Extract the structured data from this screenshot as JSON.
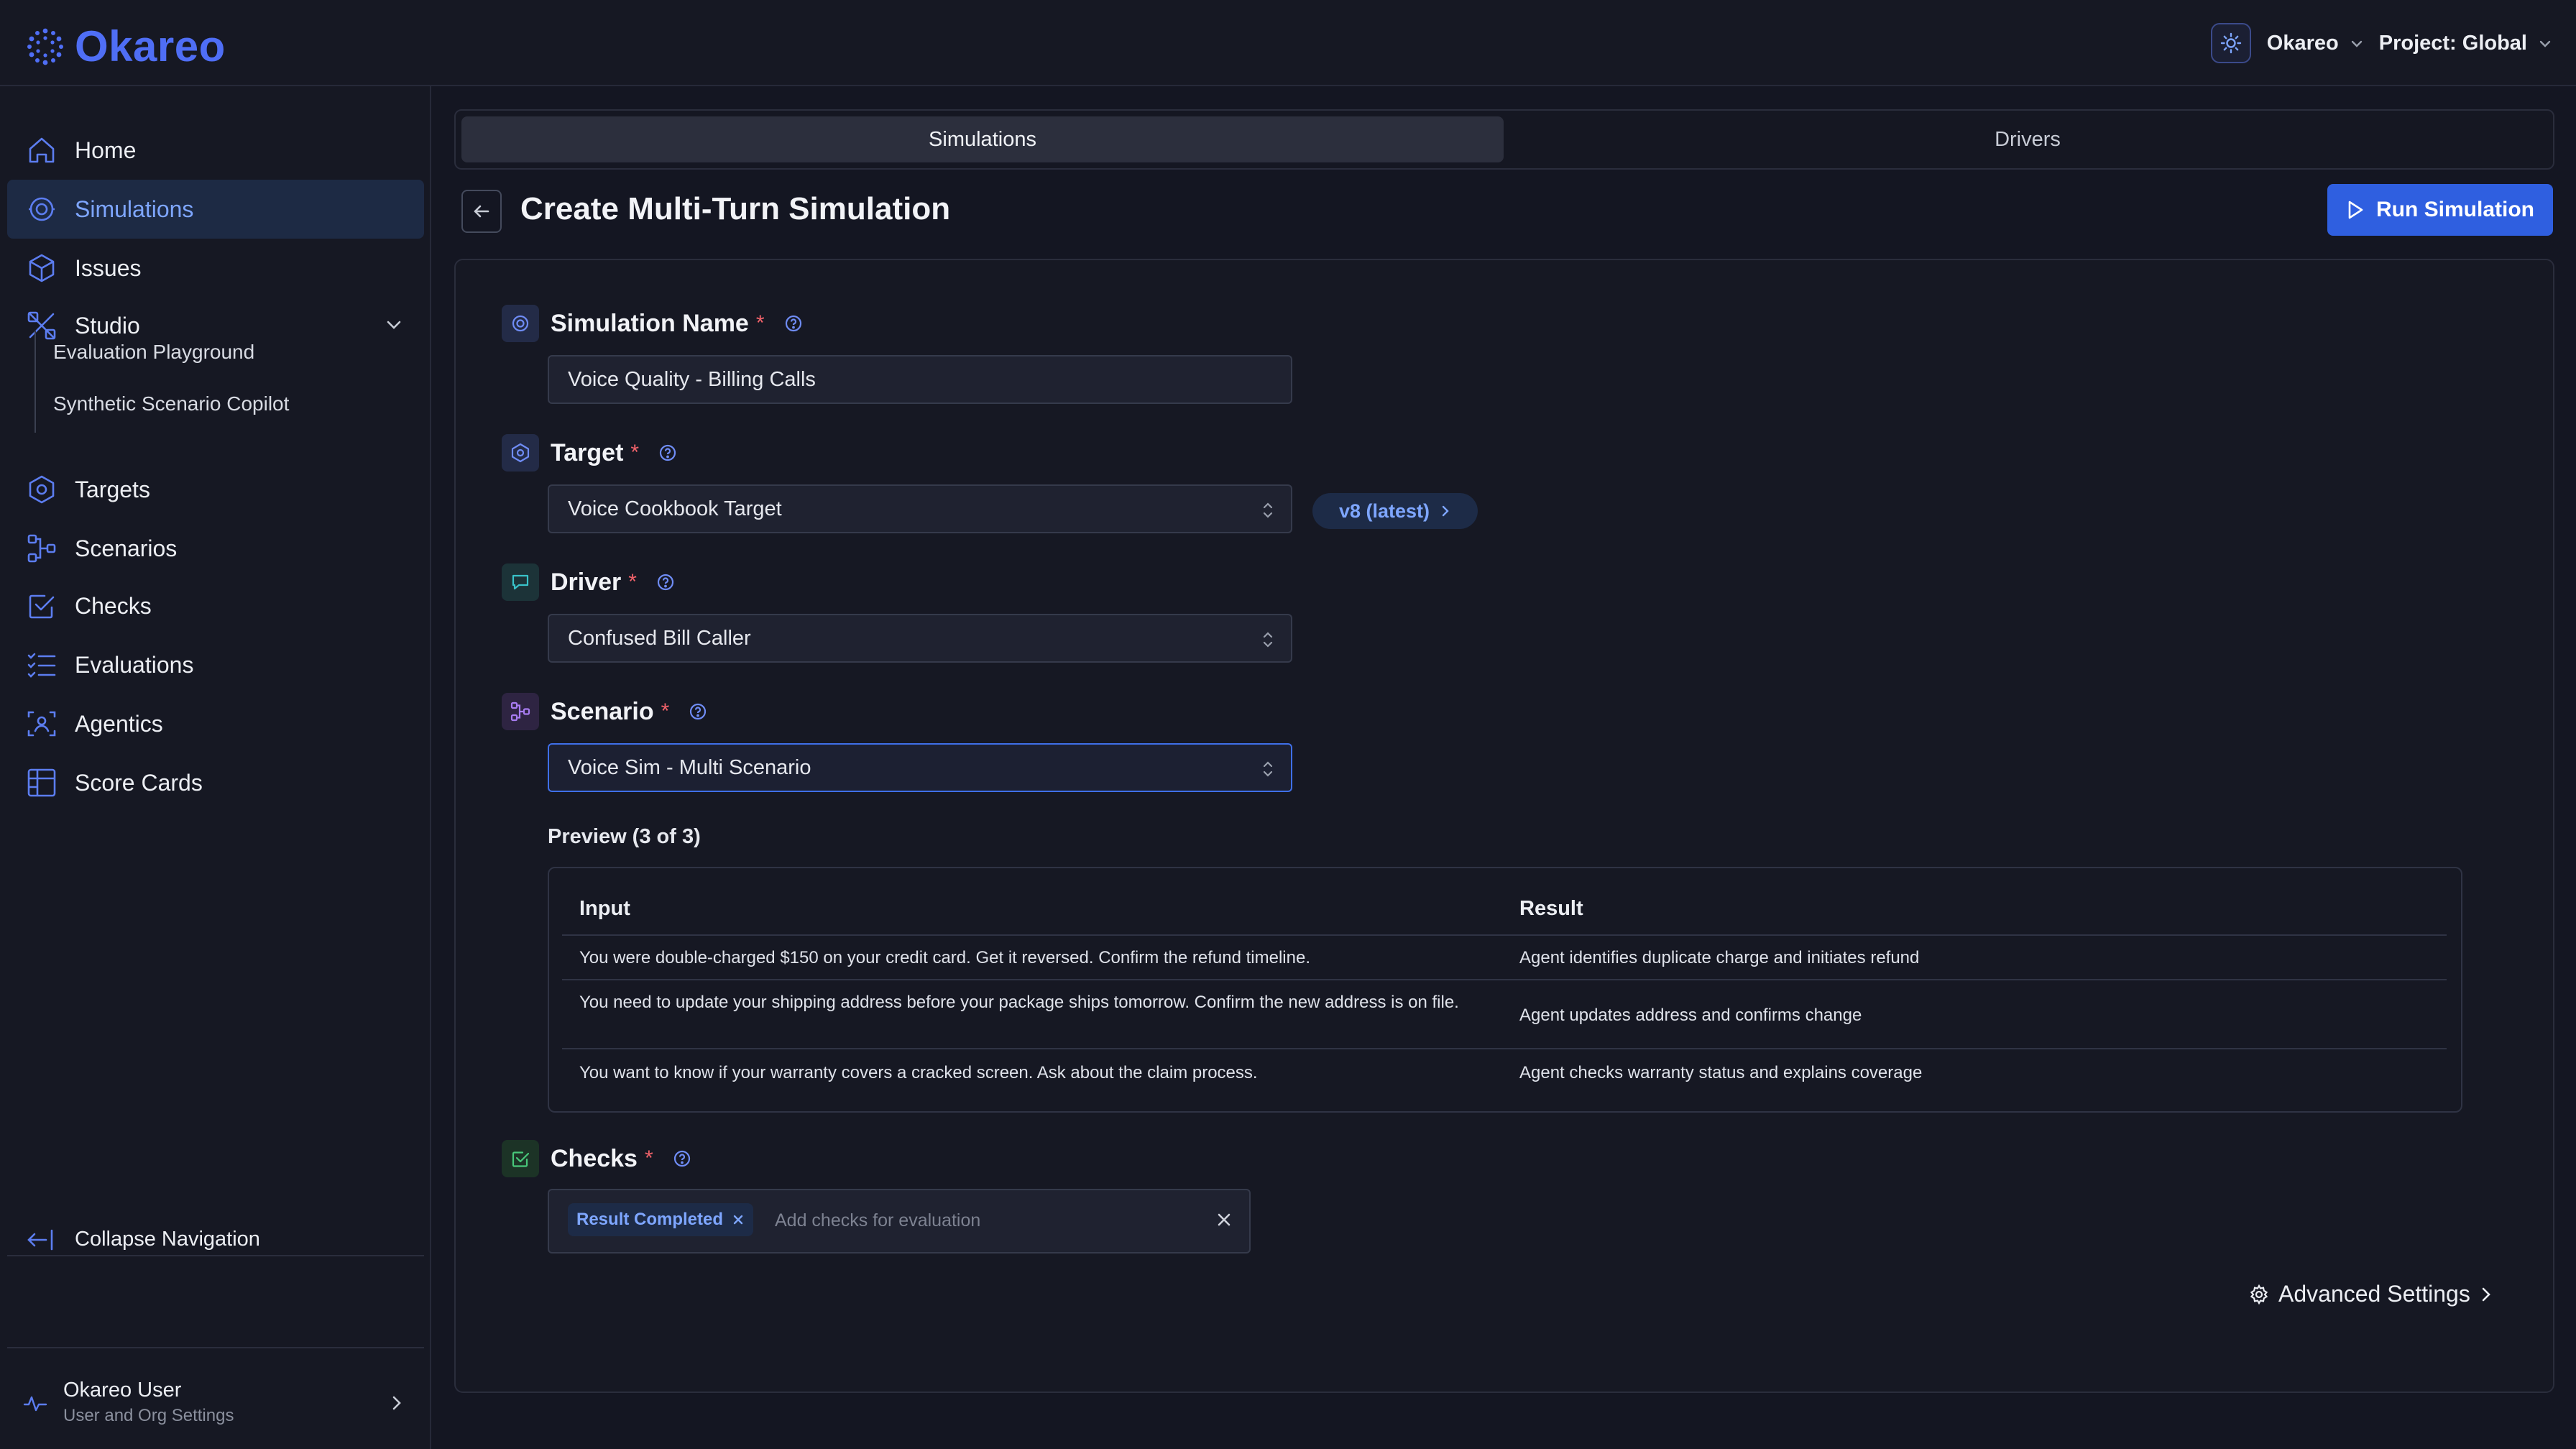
{
  "header": {
    "brand": "Okareo",
    "org": "Okareo",
    "project": "Project: Global"
  },
  "sidebar": {
    "items": [
      {
        "label": "Home"
      },
      {
        "label": "Simulations"
      },
      {
        "label": "Issues"
      },
      {
        "label": "Studio"
      },
      {
        "label": "Targets"
      },
      {
        "label": "Scenarios"
      },
      {
        "label": "Checks"
      },
      {
        "label": "Evaluations"
      },
      {
        "label": "Agentics"
      },
      {
        "label": "Score Cards"
      }
    ],
    "studio_sub": [
      "Evaluation Playground",
      "Synthetic Scenario Copilot"
    ],
    "collapse_label": "Collapse Navigation",
    "user_name": "Okareo User",
    "user_sub": "User and Org Settings"
  },
  "tabs": [
    "Simulations",
    "Drivers"
  ],
  "page": {
    "title": "Create Multi-Turn Simulation",
    "run_button": "Run Simulation"
  },
  "form": {
    "name_label": "Simulation Name",
    "name_value": "Voice Quality - Billing Calls",
    "target_label": "Target",
    "target_value": "Voice Cookbook Target",
    "target_version": "v8 (latest)",
    "driver_label": "Driver",
    "driver_value": "Confused Bill Caller",
    "scenario_label": "Scenario",
    "scenario_value": "Voice Sim - Multi Scenario",
    "required_mark": "*",
    "preview_label": "Preview (3 of 3)",
    "preview_headers": [
      "Input",
      "Result"
    ],
    "preview_rows": [
      {
        "input": "You were double-charged $150 on your credit card. Get it reversed. Confirm the refund timeline.",
        "result": "Agent identifies duplicate charge and initiates refund"
      },
      {
        "input": "You need to update your shipping address before your package ships tomorrow. Confirm the new address is on file.",
        "result": "Agent updates address and confirms change"
      },
      {
        "input": "You want to know if your warranty covers a cracked screen. Ask about the claim process.",
        "result": "Agent checks warranty status and explains coverage"
      }
    ],
    "checks_label": "Checks",
    "check_chip": "Result Completed",
    "checks_placeholder": "Add checks for evaluation",
    "advanced_settings": "Advanced Settings"
  },
  "colors": {
    "accent": "#2f5fe0",
    "brand": "#4f6ef5",
    "background": "#141622",
    "required": "#f0626a"
  }
}
